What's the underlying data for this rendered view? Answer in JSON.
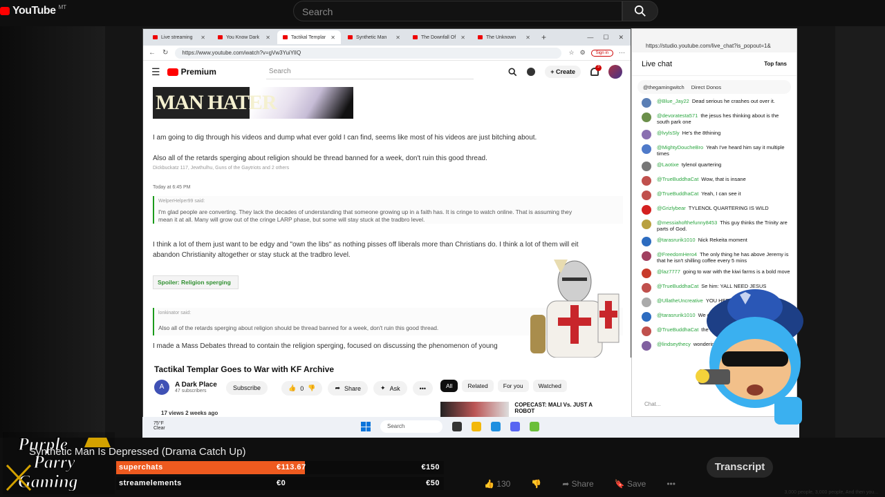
{
  "outer": {
    "brand": "YouTube",
    "brand_sup": "MT",
    "search_placeholder": "Search"
  },
  "browser": {
    "tabs": [
      {
        "label": "Live streaming"
      },
      {
        "label": "You Know Dark"
      },
      {
        "label": "Tactikal Templar"
      },
      {
        "label": "Synthetic Man"
      },
      {
        "label": "The Downfall Of"
      },
      {
        "label": "The Unknown"
      }
    ],
    "url": "https://www.youtube.com/watch?v=gVw3YuiYlIQ",
    "sign_in": "Sign in",
    "yt_brand": "Premium",
    "yt_search_placeholder": "Search",
    "create_label": "Create",
    "notif_count": "3"
  },
  "video_content": {
    "banner_text": "MAN HATER",
    "line1": "I am going to dig through his videos and dump what ever gold I can find, seems like most of his videos are just bitching about.",
    "line2": "Also all of the retards sperging about religion should be thread banned for a week, don't ruin this good thread.",
    "reactions": "Dickbuckatz 117, Jewthulhu, Guns of the Gaytriots and 2 others",
    "timestamp": "Today at 6:45 PM",
    "quote1_author": "WelperHelper99 said:",
    "quote1_text_a": "I'm glad people are converting. They lack the decades of understanding that someone growing up in a faith has. It is cringe to watch online. That is assuming they",
    "quote1_text_b": "mean it at all. Many will grow out of the cringe LARP phase, but some will stay stuck at the tradbro level.",
    "reply_a": "I think a lot of them just want to be edgy and \"own the libs\" as nothing pisses off liberals more than Christians do. I think a lot of them will eit",
    "reply_b": "abandon Christianity altogether or stay stuck at the tradbro level.",
    "spoiler": "Spoiler: Religion sperging",
    "quote2_author": "lonkinator said:",
    "quote2_text": "Also all of the retards sperging about religion should be thread banned for a week, don't ruin this good thread.",
    "line3": "I made a Mass Debates thread to contain the religion sperging, focused on discussing the phenomenon of young"
  },
  "video_info": {
    "title": "Tactikal Templar Goes to War with KF Archive",
    "channel": "A Dark Place",
    "channel_initial": "A",
    "subscribers": "47 subscribers",
    "subscribe": "Subscribe",
    "likes": "0",
    "share": "Share",
    "ask": "Ask",
    "more": "•••",
    "meta": "17 views  2 weeks ago",
    "chips": [
      "All",
      "Related",
      "For you",
      "Watched"
    ],
    "rec_title": "COPECAST: MALI Vs. JUST A ROBOT"
  },
  "chat": {
    "url": "https://studio.youtube.com/live_chat?is_popout=1&",
    "title": "Live chat",
    "top_fans": "Top fans",
    "pinned_user": "@thegamingwitch",
    "pinned_text": "Direct Donos",
    "input_placeholder": "Chat...",
    "messages": [
      {
        "author": "@Blue_Jay22",
        "text": "Dead serious he crashes out over it.",
        "color": "#5b7fb5"
      },
      {
        "author": "@devoratesta571",
        "text": "the jesus hes thinking about is the south park one",
        "color": "#6b8f4a"
      },
      {
        "author": "@lvylsSly",
        "text": "He's the 8thining",
        "color": "#8a6fb0"
      },
      {
        "author": "@MightyDoucheBro",
        "text": "Yeah I've heard him say it multiple times",
        "color": "#4f7ac9"
      },
      {
        "author": "@Laotixe",
        "text": "tylenol quartering",
        "color": "#777777"
      },
      {
        "author": "@TrueBuddhaCat",
        "text": "Wow, that is insane",
        "color": "#c0504d"
      },
      {
        "author": "@TrueBuddhaCat",
        "text": "Yeah, I can see it",
        "color": "#c0504d"
      },
      {
        "author": "@Grizlybear",
        "text": "TYLENOL QUARTERING IS WILD",
        "color": "#d42020"
      },
      {
        "author": "@messiahofthefunny8453",
        "text": "This guy thinks the Trinity are parts of God.",
        "color": "#b8a040"
      },
      {
        "author": "@tarasrurik1010",
        "text": "Nick Rekeita moment",
        "color": "#2d6cc0"
      },
      {
        "author": "@FreedomHero4",
        "text": "The only thing he has above Jeremy is that he isn't shilling coffee every 5 mins",
        "color": "#a04060"
      },
      {
        "author": "@laz7777",
        "text": "going to war with the kiwi farms is a bold move",
        "color": "#c83a2a"
      },
      {
        "author": "@TrueBuddhaCat",
        "text": "Se him: YALL NEED JESUS",
        "color": "#c0504d"
      },
      {
        "author": "@UllatheUncreative",
        "text": "YOU HERE-",
        "color": "#aaaaaa"
      },
      {
        "author": "@tarasrurik1010",
        "text": "We out and do",
        "color": "#2d6cc0"
      },
      {
        "author": "@TrueBuddhaCat",
        "text": "the thread, mak",
        "color": "#c0504d"
      },
      {
        "author": "@lindseythecy",
        "text": "wondering wha unfollowed hi fuuuuuuck",
        "color": "#8060a0"
      }
    ]
  },
  "taskbar": {
    "weather_temp": "75°F",
    "weather_desc": "Clear",
    "search": "Search"
  },
  "overlay": {
    "title": "Synthetic Man Is Depressed (Drama Catch Up)",
    "logo_line1": "Purple",
    "logo_line2": "Parry",
    "logo_line3": "Gaming",
    "bars": [
      {
        "name": "superchats",
        "current": "€113.67",
        "goal": "€150",
        "fill_fraction": 0.758,
        "color": "#ee5a1f"
      },
      {
        "name": "streamelements",
        "current": "€0",
        "goal": "€50",
        "fill_fraction": 0,
        "color": "#ee5a1f"
      }
    ]
  },
  "page_actions": {
    "likes": "130",
    "share": "Share",
    "save": "Save",
    "more": "•••",
    "transcript": "Transcript",
    "footer": "3,000 people, 3,000 people, And then you..."
  }
}
